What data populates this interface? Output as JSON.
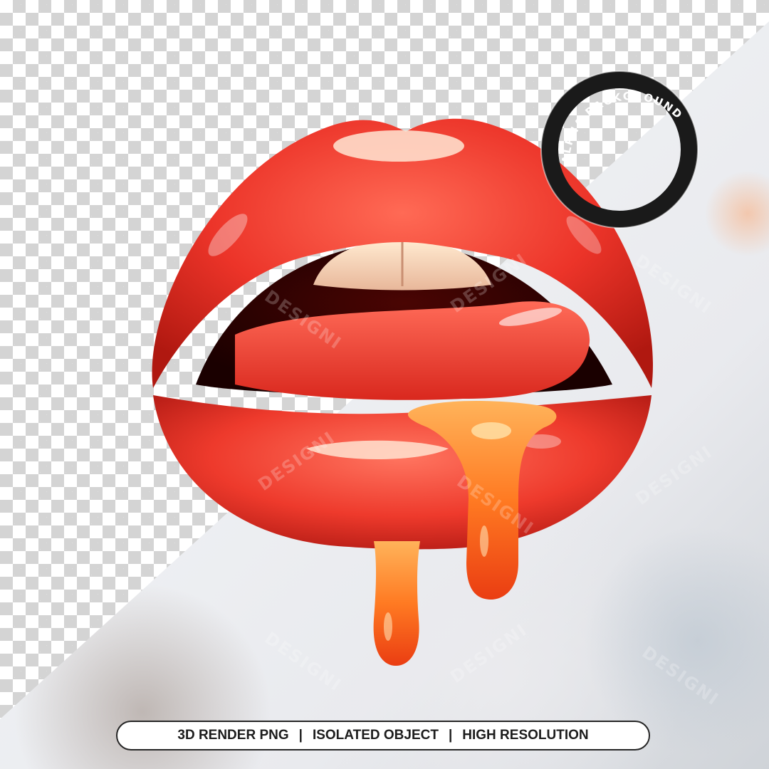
{
  "stamp": {
    "text": "ALPHA BACKGROUND"
  },
  "watermark": {
    "text": "DESIGNI"
  },
  "badge": {
    "item1": "3D RENDER PNG",
    "item2": "ISOLATED OBJECT",
    "item3": "HIGH RESOLUTION",
    "separator": "|"
  },
  "colors": {
    "lip": "#e8302a",
    "lip_dark": "#a3140f",
    "drip": "#ff7a1e",
    "stamp_ring": "#1a1a1a"
  }
}
